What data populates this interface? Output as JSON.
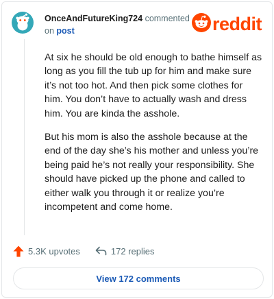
{
  "header": {
    "username": "OnceAndFutureKing724",
    "action_text": "commented",
    "on_text": "on",
    "post_link": "post"
  },
  "brand": {
    "logo_text": "reddit",
    "logo_icon": "reddit-snoo-icon",
    "color": "#ff4500"
  },
  "avatar": {
    "icon": "snoo-avatar-icon",
    "background": "#34a8b8"
  },
  "comment": {
    "paragraphs": [
      "At six he should be old enough to bathe himself as long as you fill the tub up for him and make sure it’s not too hot. And then pick some clothes for him. You don’t have to actually wash and dress him. You are kinda the asshole.",
      "But his mom is also the asshole because at the end of the day she’s his mother and unless you’re being paid he’s not really your responsibility. She should have picked up the phone and called to either walk you through it or realize you’re incompetent and come home."
    ]
  },
  "actions": {
    "upvotes": "5.3K upvotes",
    "upvote_icon": "upvote-arrow-icon",
    "upvote_color": "#ff4500",
    "replies": "172 replies",
    "reply_icon": "reply-arrow-icon"
  },
  "view_button": {
    "label": "View 172 comments",
    "color": "#1c5bb6"
  }
}
